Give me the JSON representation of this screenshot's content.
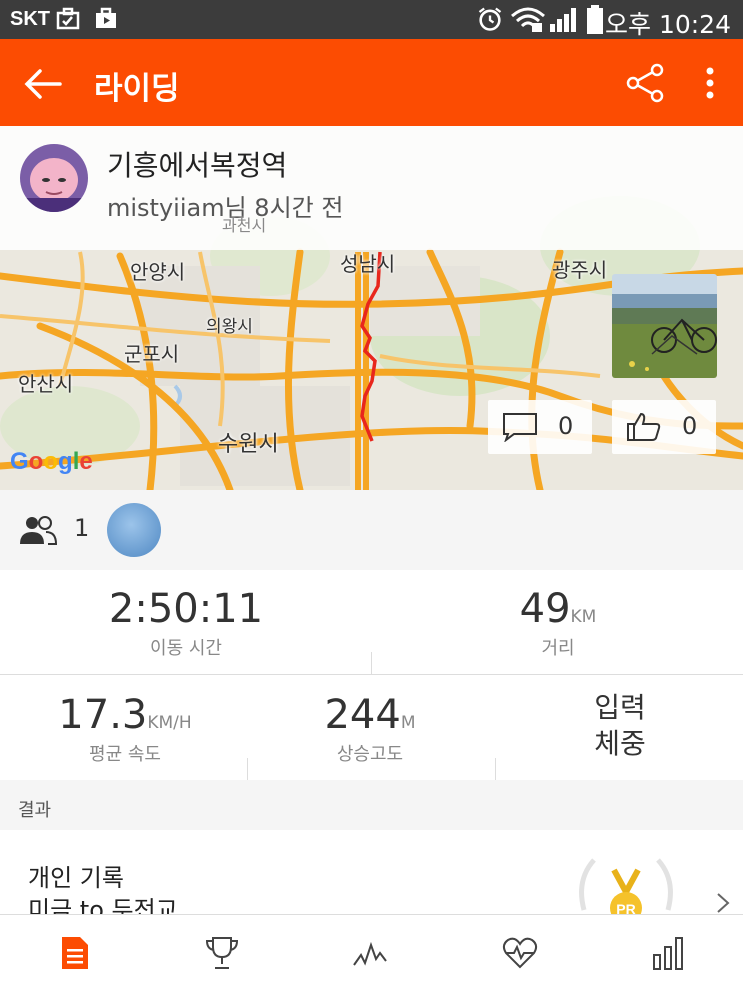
{
  "statusbar": {
    "carrier": "SKT",
    "time": "오후 10:24"
  },
  "appbar": {
    "title": "라이딩"
  },
  "activity": {
    "name": "기흥에서복정역",
    "subtitle": "mistyiiam님 8시간 전"
  },
  "map": {
    "labels": [
      "성남시",
      "광주시",
      "안양시",
      "의왕시",
      "군포시",
      "안산시",
      "수원시",
      "과천시"
    ],
    "google": "Google",
    "route_color": "#e8261c"
  },
  "social": {
    "comments": "0",
    "kudos": "0"
  },
  "athletes": {
    "count": "1"
  },
  "stats": {
    "moving_time": {
      "value": "2:50:11",
      "label": "이동 시간"
    },
    "distance": {
      "value": "49",
      "unit": "KM",
      "label": "거리"
    },
    "avg_speed": {
      "value": "17.3",
      "unit": "KM/H",
      "label": "평균 속도"
    },
    "elevation": {
      "value": "244",
      "unit": "M",
      "label": "상승고도"
    },
    "weight": {
      "line1": "입력",
      "line2": "체중"
    }
  },
  "results": {
    "header": "결과",
    "pr_title": "개인 기록",
    "pr_segment": "미금 to 두전교",
    "medal_text": "PR"
  },
  "nav": [
    "overview-icon",
    "trophy-icon",
    "analysis-icon",
    "heart-rate-icon",
    "stats-bars-icon"
  ],
  "colors": {
    "accent": "#fc4c02",
    "statusbar": "#3c3c3c",
    "road": "#f5a623"
  }
}
